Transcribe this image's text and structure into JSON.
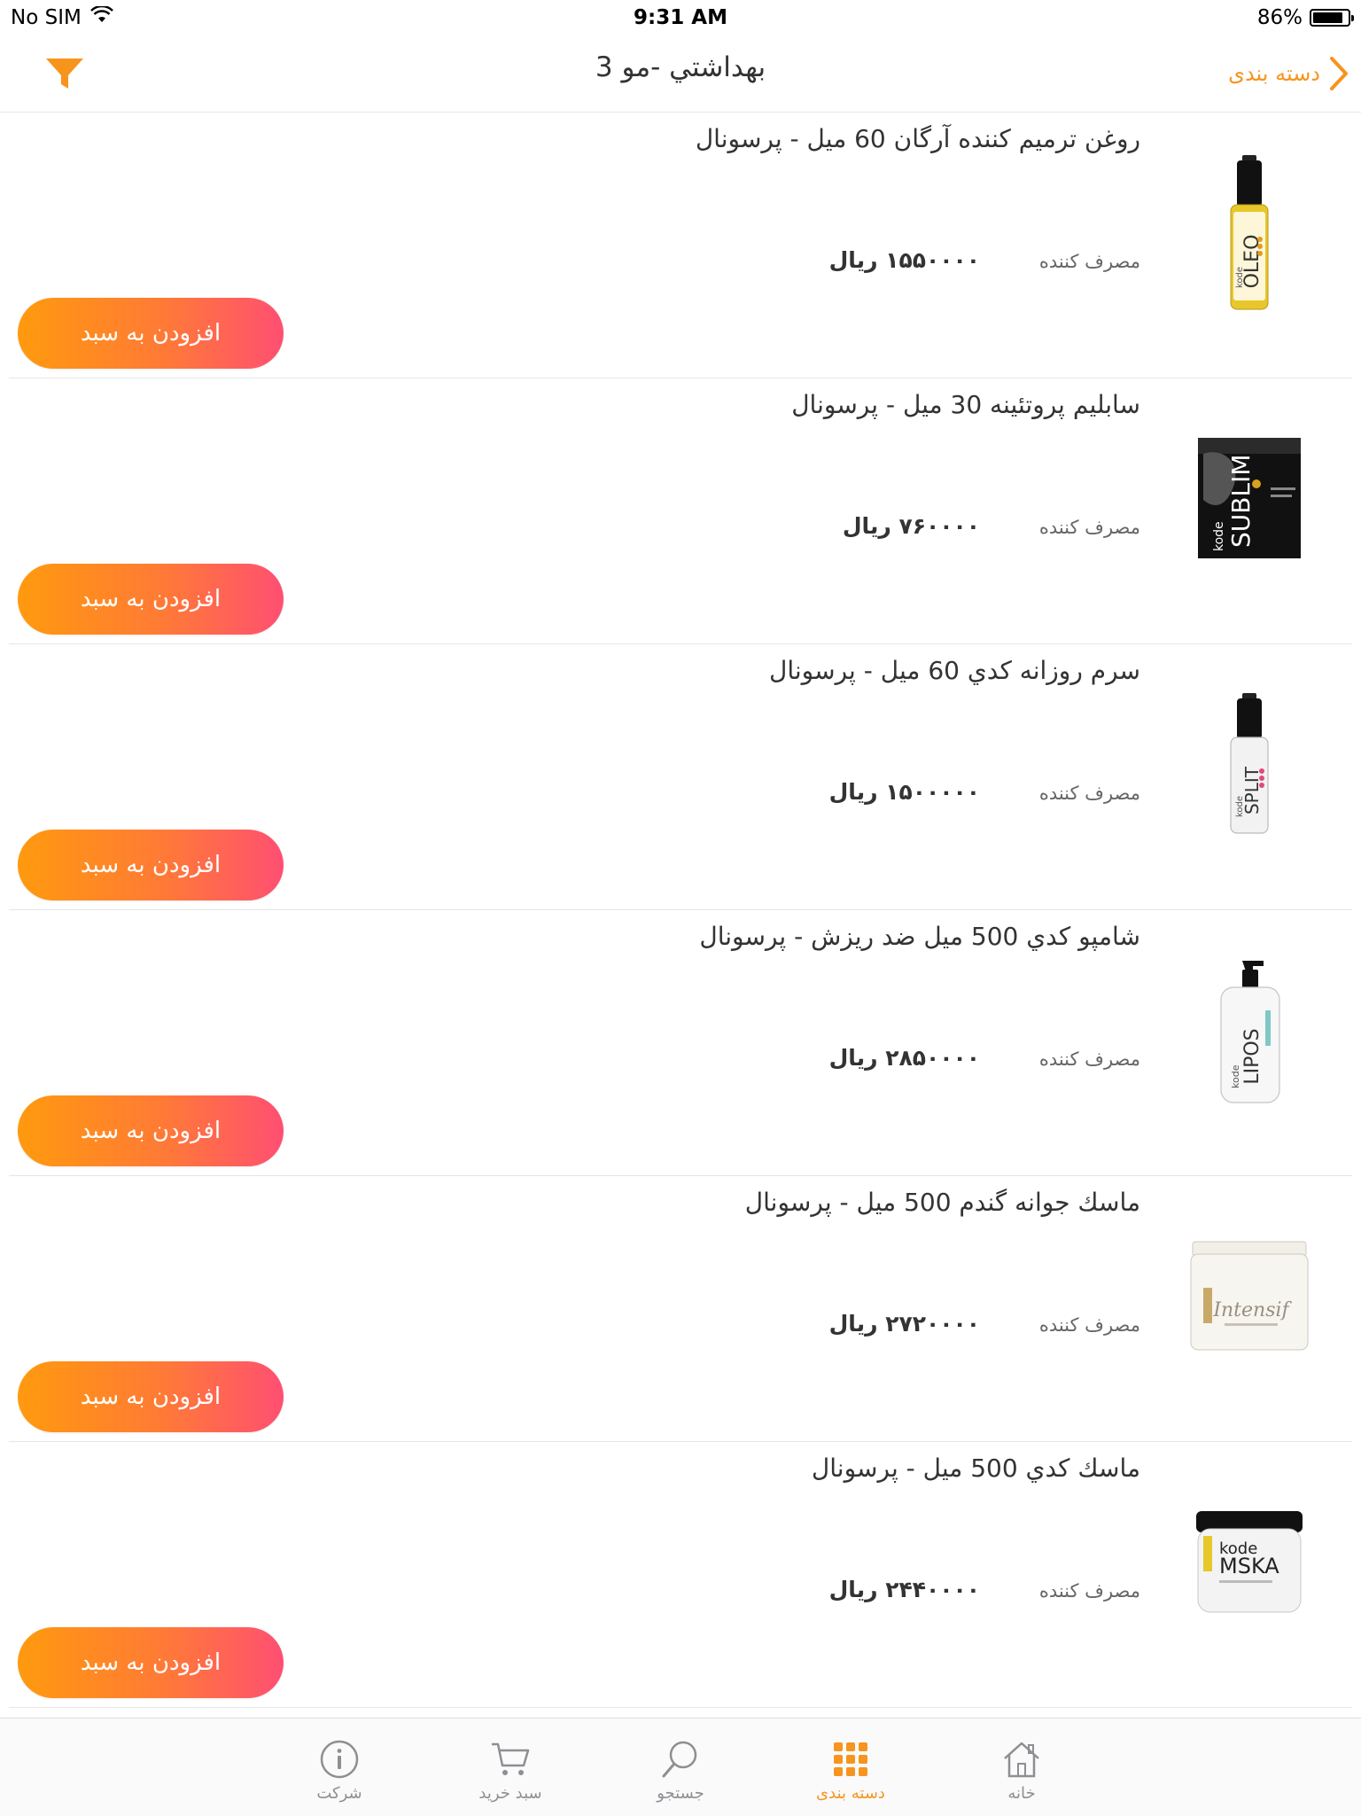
{
  "status_bar": {
    "carrier": "No SIM",
    "time": "9:31 AM",
    "battery_percent": "86%",
    "battery_level": 0.86
  },
  "nav_bar": {
    "title": "بهداشتي -مو 3",
    "back_label": "دسته بندی"
  },
  "products": [
    {
      "name": "روغن ترميم كننده آرگان 60 ميل - پرسونال",
      "consumer_label": "مصرف کننده",
      "price": "۱۵۵۰۰۰۰",
      "currency": "ریال",
      "add_label": "افزودن به سبد",
      "image": "oil-bottle-image"
    },
    {
      "name": "سابليم پروتئينه 30 ميل - پرسونال",
      "consumer_label": "مصرف کننده",
      "price": "۷۶۰۰۰۰",
      "currency": "ریال",
      "add_label": "افزودن به سبد",
      "image": "sachet-image"
    },
    {
      "name": "سرم روزانه كدي 60 ميل - پرسونال",
      "consumer_label": "مصرف کننده",
      "price": "۱۵۰۰۰۰۰",
      "currency": "ریال",
      "add_label": "افزودن به سبد",
      "image": "serum-bottle-image"
    },
    {
      "name": "شامپو كدي 500 ميل ضد ريزش  - پرسونال",
      "consumer_label": "مصرف کننده",
      "price": "۲۸۵۰۰۰۰",
      "currency": "ریال",
      "add_label": "افزودن به سبد",
      "image": "shampoo-bottle-image"
    },
    {
      "name": "ماسك جوانه گندم 500 ميل  - پرسونال",
      "consumer_label": "مصرف کننده",
      "price": "۲۷۲۰۰۰۰",
      "currency": "ریال",
      "add_label": "افزودن به سبد",
      "image": "mask-jar-image"
    },
    {
      "name": "ماسك كدي 500 ميل - پرسونال",
      "consumer_label": "مصرف کننده",
      "price": "۲۴۴۰۰۰۰",
      "currency": "ریال",
      "add_label": "افزودن به سبد",
      "image": "mask-jar-image"
    }
  ],
  "product_images": [
    {
      "brand": "kode",
      "line": "OLEO"
    },
    {
      "brand": "kode",
      "line": "SUBLIM"
    },
    {
      "brand": "kode",
      "line": "SPLIT"
    },
    {
      "brand": "kode",
      "line": "LIPOS"
    },
    {
      "brand": "Intensif",
      "line": ""
    },
    {
      "brand": "kode",
      "line": "MSKA"
    }
  ],
  "tab_bar": {
    "company": "شرکت",
    "cart": "سبد خرید",
    "search": "جستجو",
    "categories": "دسته بندی",
    "home": "خانه",
    "active": "categories"
  },
  "colors": {
    "accent": "#f7941d",
    "button_start": "#ff9a0e",
    "button_end": "#ff4f72"
  }
}
